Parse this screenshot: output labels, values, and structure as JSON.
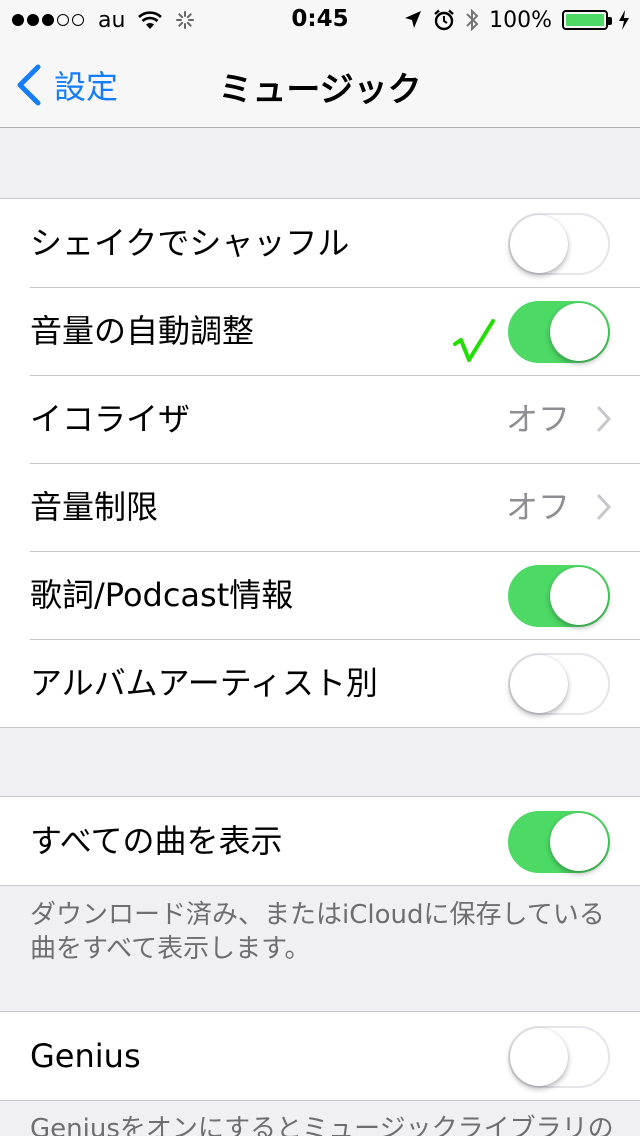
{
  "status_bar": {
    "carrier": "au",
    "time": "0:45",
    "battery": "100%",
    "signal_bars_filled": 3,
    "signal_bars_total": 5
  },
  "nav": {
    "back_label": "設定",
    "title": "ミュージック"
  },
  "groups": [
    {
      "rows": [
        {
          "label": "シェイクでシャッフル",
          "type": "toggle",
          "on": false
        },
        {
          "label": "音量の自動調整",
          "type": "toggle",
          "on": true
        },
        {
          "label": "イコライザ",
          "type": "disclosure",
          "value": "オフ"
        },
        {
          "label": "音量制限",
          "type": "disclosure",
          "value": "オフ"
        },
        {
          "label": "歌詞/Podcast情報",
          "type": "toggle",
          "on": true
        },
        {
          "label": "アルバムアーティスト別",
          "type": "toggle",
          "on": false
        }
      ]
    },
    {
      "rows": [
        {
          "label": "すべての曲を表示",
          "type": "toggle",
          "on": true
        }
      ],
      "footer": "ダウンロード済み、またはiCloudに保存している曲をすべて表示します。"
    },
    {
      "rows": [
        {
          "label": "Genius",
          "type": "toggle",
          "on": false
        }
      ],
      "footer": "Geniusをオンにするとミュージックライブラリの"
    }
  ],
  "colors": {
    "accent_blue": "#157efb",
    "toggle_on_green": "#4cd964",
    "annotation_check": "#22dd00"
  },
  "annotation": {
    "icon": "checkmark-icon"
  }
}
